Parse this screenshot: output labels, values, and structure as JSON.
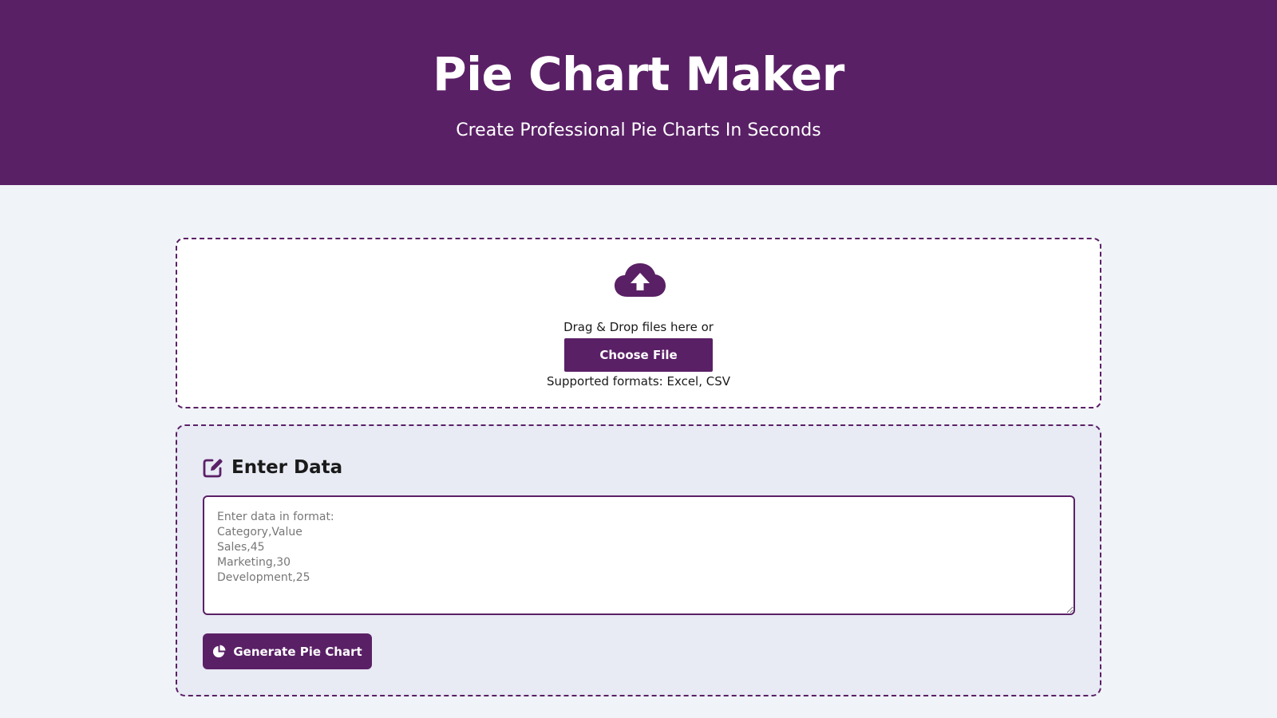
{
  "header": {
    "title": "Pie Chart Maker",
    "subtitle": "Create Professional Pie Charts In Seconds"
  },
  "upload": {
    "icon": "cloud-upload-icon",
    "drop_text": "Drag & Drop files here or",
    "choose_label": "Choose File",
    "formats_text": "Supported formats: Excel, CSV"
  },
  "data_entry": {
    "icon": "edit-icon",
    "heading": "Enter Data",
    "placeholder": "Enter data in format:\nCategory,Value\nSales,45\nMarketing,30\nDevelopment,25",
    "value": "",
    "generate_label": "Generate Pie Chart",
    "generate_icon": "pie-chart-icon"
  },
  "colors": {
    "brand": "#5a2066",
    "page_background": "#f0f3f7",
    "data_panel_background": "#e8eaf4"
  }
}
